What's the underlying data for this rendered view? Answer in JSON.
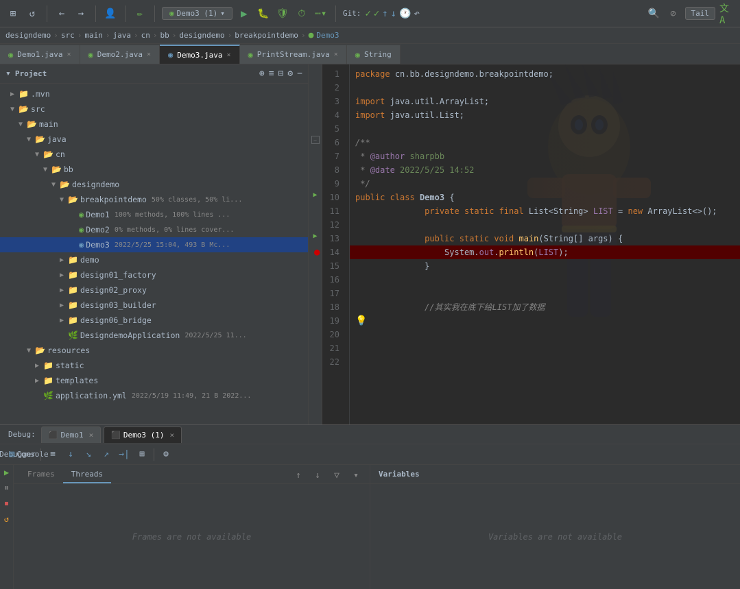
{
  "toolbar": {
    "project_btn": "Demo3 (1)",
    "run_label": "▶",
    "git_label": "Git:",
    "tail_label": "Tail",
    "translate_label": "A"
  },
  "breadcrumb": {
    "items": [
      "designdemo",
      "src",
      "main",
      "java",
      "cn",
      "bb",
      "designdemo",
      "breakpointdemo",
      "Demo3"
    ]
  },
  "tabs": [
    {
      "id": "demo1",
      "label": "Demo1.java",
      "active": false
    },
    {
      "id": "demo2",
      "label": "Demo2.java",
      "active": false
    },
    {
      "id": "demo3",
      "label": "Demo3.java",
      "active": true
    },
    {
      "id": "printstream",
      "label": "PrintStream.java",
      "active": false
    },
    {
      "id": "string",
      "label": "String",
      "active": false
    }
  ],
  "code": {
    "lines": [
      {
        "num": 1,
        "content": "package cn.bb.designdemo.breakpointdemo;",
        "type": "normal"
      },
      {
        "num": 2,
        "content": "",
        "type": "normal"
      },
      {
        "num": 3,
        "content": "import java.util.ArrayList;",
        "type": "normal"
      },
      {
        "num": 4,
        "content": "import java.util.List;",
        "type": "normal"
      },
      {
        "num": 5,
        "content": "",
        "type": "normal"
      },
      {
        "num": 6,
        "content": "/**",
        "type": "comment"
      },
      {
        "num": 7,
        "content": " * @author sharpbb",
        "type": "comment_author"
      },
      {
        "num": 8,
        "content": " * @date 2022/5/25 14:52",
        "type": "comment_date"
      },
      {
        "num": 9,
        "content": " */",
        "type": "comment"
      },
      {
        "num": 10,
        "content": "public class Demo3 {",
        "type": "class_def",
        "has_arrow": true
      },
      {
        "num": 11,
        "content": "    private static final List<String> LIST = new ArrayList<>();",
        "type": "field"
      },
      {
        "num": 12,
        "content": "",
        "type": "normal"
      },
      {
        "num": 13,
        "content": "    public static void main(String[] args) {",
        "type": "method_def",
        "has_arrow": true
      },
      {
        "num": 14,
        "content": "        System.out.println(LIST);",
        "type": "breakpoint"
      },
      {
        "num": 15,
        "content": "    }",
        "type": "normal"
      },
      {
        "num": 16,
        "content": "",
        "type": "normal"
      },
      {
        "num": 17,
        "content": "",
        "type": "normal"
      },
      {
        "num": 18,
        "content": "    //其实我在底下给LIST加了数据",
        "type": "comment_inline"
      },
      {
        "num": 19,
        "content": "",
        "type": "tip"
      },
      {
        "num": 20,
        "content": "",
        "type": "normal"
      },
      {
        "num": 21,
        "content": "",
        "type": "normal"
      },
      {
        "num": 22,
        "content": "",
        "type": "normal"
      }
    ]
  },
  "project": {
    "title": "Project",
    "tree": [
      {
        "id": "mvn",
        "label": ".mvn",
        "type": "folder",
        "indent": 1,
        "expanded": false
      },
      {
        "id": "src",
        "label": "src",
        "type": "folder",
        "indent": 1,
        "expanded": true
      },
      {
        "id": "main",
        "label": "main",
        "type": "folder",
        "indent": 2,
        "expanded": true
      },
      {
        "id": "java",
        "label": "java",
        "type": "folder",
        "indent": 3,
        "expanded": true
      },
      {
        "id": "cn",
        "label": "cn",
        "type": "folder",
        "indent": 4,
        "expanded": true
      },
      {
        "id": "bb",
        "label": "bb",
        "type": "folder",
        "indent": 5,
        "expanded": true
      },
      {
        "id": "designdemo",
        "label": "designdemo",
        "type": "folder",
        "indent": 6,
        "expanded": true
      },
      {
        "id": "breakpointdemo",
        "label": "breakpointdemo",
        "type": "folder",
        "indent": 7,
        "expanded": true,
        "coverage": "50% classes, 50% li..."
      },
      {
        "id": "demo1",
        "label": "Demo1",
        "type": "java",
        "indent": 8,
        "coverage": "100% methods, 100% lines ..."
      },
      {
        "id": "demo2",
        "label": "Demo2",
        "type": "java",
        "indent": 8,
        "coverage": "0% methods, 0% lines cover..."
      },
      {
        "id": "demo3",
        "label": "Demo3",
        "type": "java_active",
        "indent": 8,
        "selected": true,
        "date": "2022/5/25 15:04, 493 B Mc..."
      },
      {
        "id": "demo_folder",
        "label": "demo",
        "type": "folder",
        "indent": 7,
        "expanded": false
      },
      {
        "id": "design01",
        "label": "design01_factory",
        "type": "folder",
        "indent": 7,
        "expanded": false
      },
      {
        "id": "design02",
        "label": "design02_proxy",
        "type": "folder",
        "indent": 7,
        "expanded": false
      },
      {
        "id": "design03",
        "label": "design03_builder",
        "type": "folder",
        "indent": 7,
        "expanded": false
      },
      {
        "id": "design06",
        "label": "design06_bridge",
        "type": "folder",
        "indent": 7,
        "expanded": false
      },
      {
        "id": "designapp",
        "label": "DesigndemoApplication",
        "type": "spring",
        "indent": 7,
        "date": "2022/5/25 11..."
      },
      {
        "id": "resources",
        "label": "resources",
        "type": "folder",
        "indent": 3,
        "expanded": true
      },
      {
        "id": "static",
        "label": "static",
        "type": "folder",
        "indent": 4,
        "expanded": false
      },
      {
        "id": "templates",
        "label": "templates",
        "type": "folder",
        "indent": 4,
        "expanded": false
      },
      {
        "id": "appyml",
        "label": "application.yml",
        "type": "yml",
        "indent": 4,
        "date": "2022/5/19 11:49, 21 B 2022..."
      }
    ]
  },
  "debug": {
    "label": "Debug:",
    "sessions": [
      {
        "id": "demo1",
        "label": "Demo1",
        "active": false
      },
      {
        "id": "demo3",
        "label": "Demo3 (1)",
        "active": true
      }
    ],
    "tools": {
      "debugger_label": "Debugger",
      "console_label": "Console"
    },
    "subtabs": {
      "frames_label": "Frames",
      "threads_label": "Threads"
    },
    "frames_empty": "Frames are not available",
    "variables_label": "Variables",
    "variables_empty": "Variables are not available"
  }
}
